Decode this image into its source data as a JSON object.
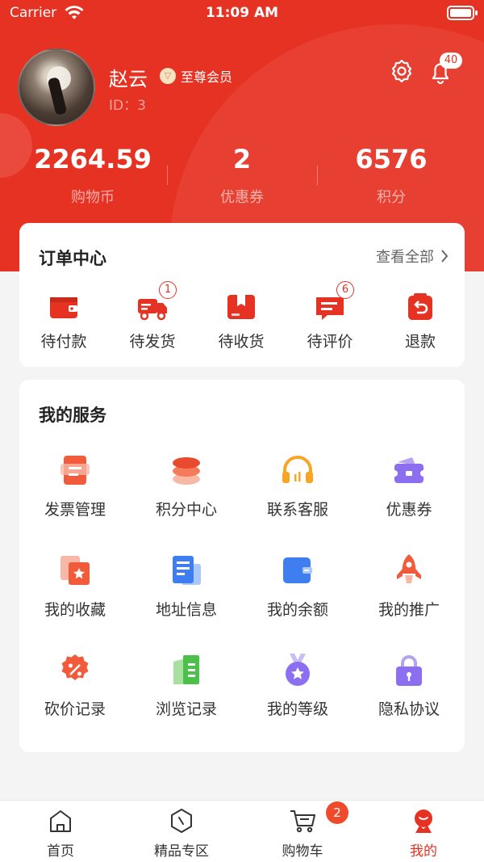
{
  "status_bar": {
    "carrier": "Carrier",
    "time": "11:09 AM"
  },
  "profile": {
    "name": "赵云",
    "vip_label": "至尊会员",
    "id_text": "ID：3",
    "notification_count": "40"
  },
  "stats": [
    {
      "value": "2264.59",
      "label": "购物币"
    },
    {
      "value": "2",
      "label": "优惠券"
    },
    {
      "value": "6576",
      "label": "积分"
    }
  ],
  "orders": {
    "title": "订单中心",
    "view_all": "查看全部",
    "items": [
      {
        "label": "待付款",
        "icon": "wallet-icon",
        "badge": ""
      },
      {
        "label": "待发货",
        "icon": "truck-icon",
        "badge": "1"
      },
      {
        "label": "待收货",
        "icon": "box-icon",
        "badge": ""
      },
      {
        "label": "待评价",
        "icon": "comment-icon",
        "badge": "6"
      },
      {
        "label": "退款",
        "icon": "refund-icon",
        "badge": ""
      }
    ]
  },
  "services": {
    "title": "我的服务",
    "items": [
      {
        "label": "发票管理",
        "icon": "invoice-icon"
      },
      {
        "label": "积分中心",
        "icon": "coins-icon"
      },
      {
        "label": "联系客服",
        "icon": "headset-icon"
      },
      {
        "label": "优惠券",
        "icon": "coupon-icon"
      },
      {
        "label": "我的收藏",
        "icon": "favorite-icon"
      },
      {
        "label": "地址信息",
        "icon": "address-icon"
      },
      {
        "label": "我的余额",
        "icon": "balance-wallet-icon"
      },
      {
        "label": "我的推广",
        "icon": "rocket-icon"
      },
      {
        "label": "砍价记录",
        "icon": "discount-icon"
      },
      {
        "label": "浏览记录",
        "icon": "history-icon"
      },
      {
        "label": "我的等级",
        "icon": "medal-icon"
      },
      {
        "label": "隐私协议",
        "icon": "lock-icon"
      }
    ]
  },
  "tabbar": {
    "items": [
      {
        "label": "首页",
        "icon": "home-icon"
      },
      {
        "label": "精品专区",
        "icon": "compass-icon"
      },
      {
        "label": "购物车",
        "icon": "cart-icon"
      },
      {
        "label": "我的",
        "icon": "profile-icon"
      }
    ],
    "cart_badge": "2",
    "active_index": 3
  },
  "colors": {
    "brand_red": "#e63223",
    "badge_red": "#f04a2c"
  }
}
